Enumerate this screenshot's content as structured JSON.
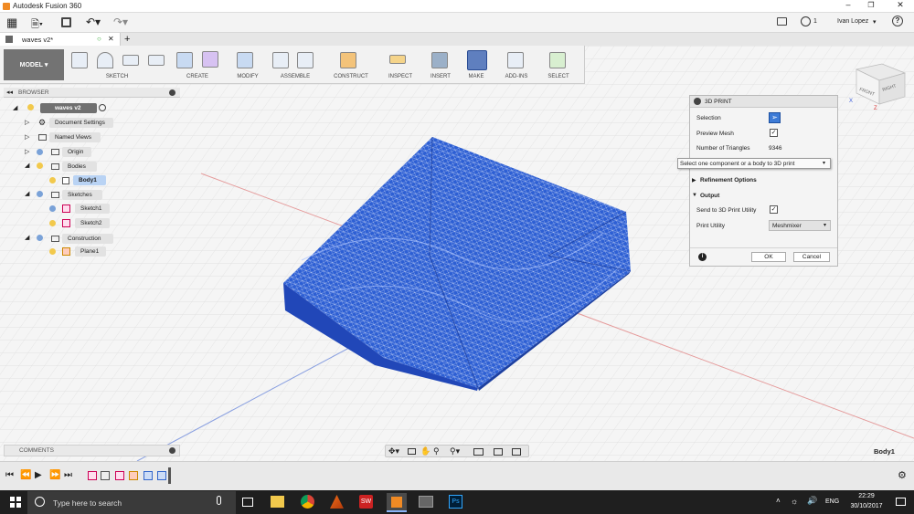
{
  "app": {
    "title": "Autodesk Fusion 360",
    "user": "Ivan Lopez",
    "notif_count": "1"
  },
  "document": {
    "tab_label": "waves v2*"
  },
  "ribbon": {
    "mode": "MODEL",
    "groups": [
      "SKETCH",
      "CREATE",
      "MODIFY",
      "ASSEMBLE",
      "CONSTRUCT",
      "INSPECT",
      "INSERT",
      "MAKE",
      "ADD-INS",
      "SELECT"
    ]
  },
  "browser": {
    "title": "BROWSER",
    "root": "waves v2",
    "items": {
      "doc_settings": "Document Settings",
      "named_views": "Named Views",
      "origin": "Origin",
      "bodies": "Bodies",
      "body1": "Body1",
      "sketches": "Sketches",
      "sketch1": "Sketch1",
      "sketch2": "Sketch2",
      "construction": "Construction",
      "plane1": "Plane1"
    }
  },
  "dialog": {
    "title": "3D PRINT",
    "selection_label": "Selection",
    "preview_mesh_label": "Preview Mesh",
    "num_triangles_label": "Number of Triangles",
    "num_triangles_value": "9346",
    "tooltip": "Select one component or a body to 3D print",
    "refinement": "Refinement Options",
    "output": "Output",
    "send_label": "Send to 3D Print Utility",
    "print_utility_label": "Print Utility",
    "print_utility_value": "Meshmixer",
    "ok": "OK",
    "cancel": "Cancel"
  },
  "viewcube": {
    "face": "FRONT",
    "side": "RIGHT",
    "axis_x": "X",
    "axis_z": "Z"
  },
  "comments": {
    "title": "COMMENTS"
  },
  "status": {
    "selected": "Body1"
  },
  "taskbar": {
    "search_placeholder": "Type here to search",
    "lang": "ENG",
    "time": "22:29",
    "date": "30/10/2017"
  },
  "colors": {
    "mesh": "#2d5fd4",
    "mesh_dark": "#1c3fa0",
    "model_btn": "#737373",
    "taskbar": "#1f1f1f"
  }
}
